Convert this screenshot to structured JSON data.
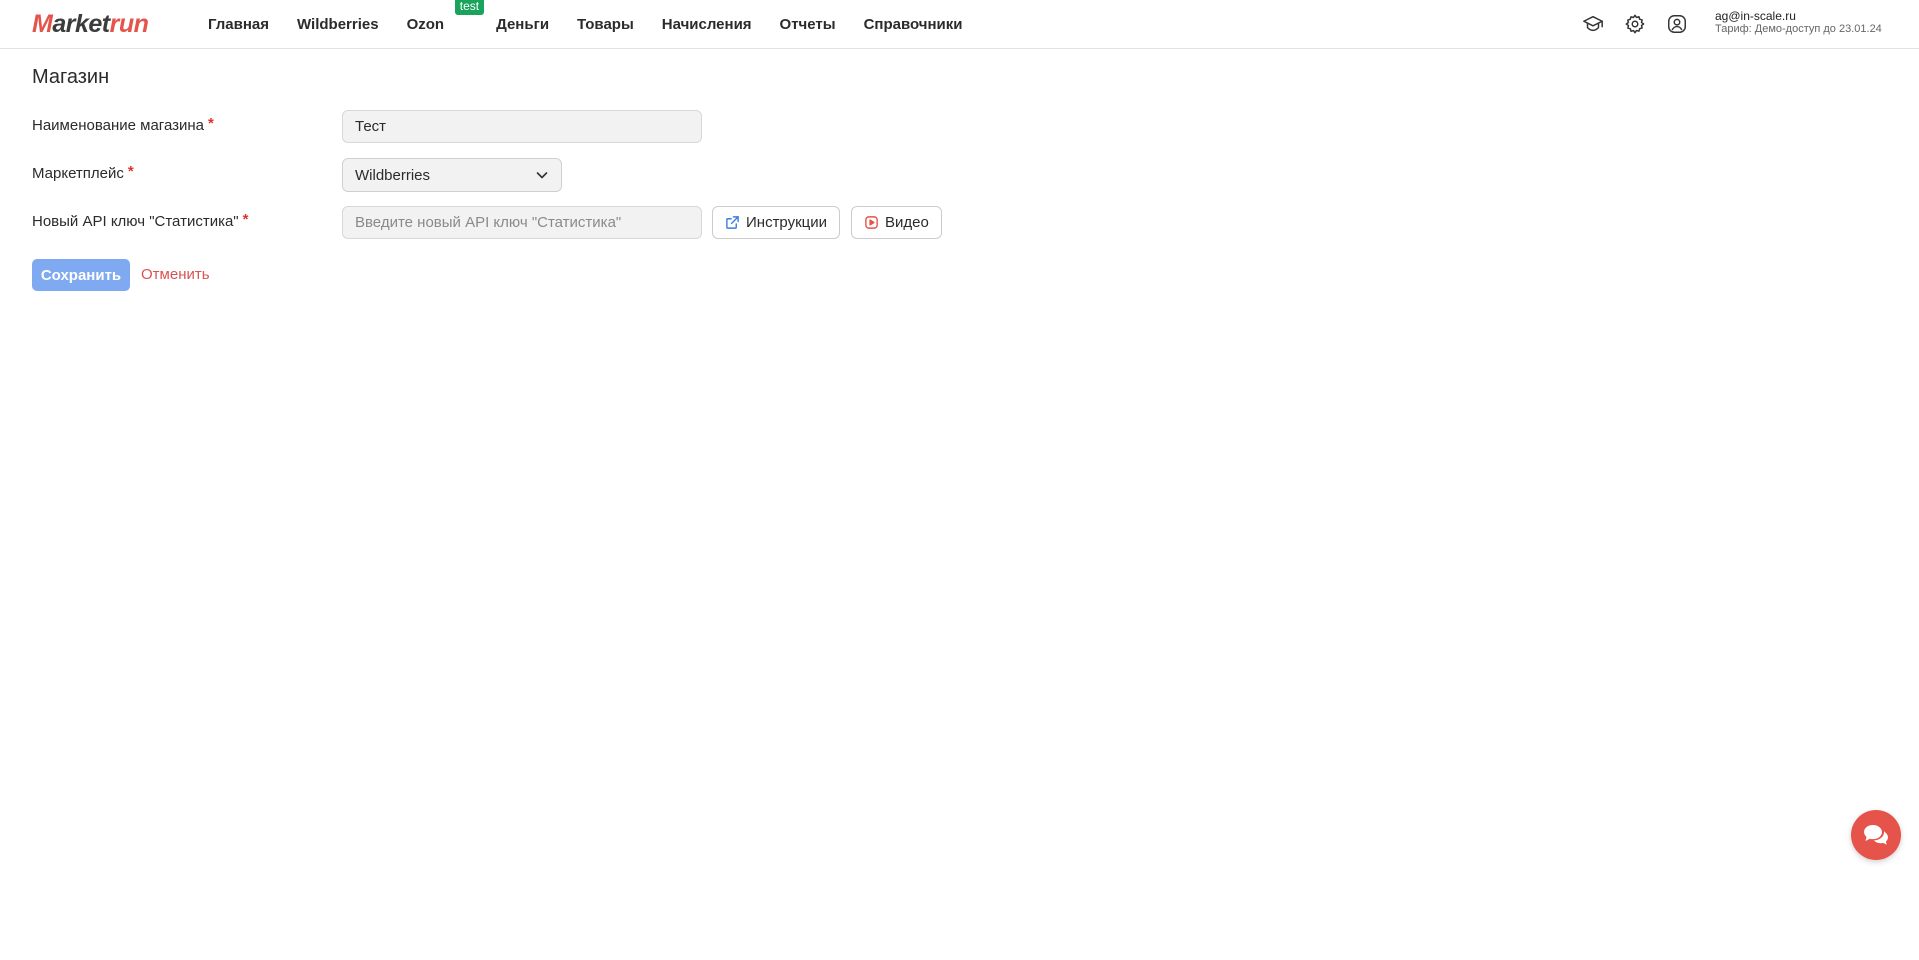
{
  "header": {
    "logo": {
      "m": "M",
      "mid": "arket",
      "run": "run"
    },
    "nav": [
      {
        "label": "Главная"
      },
      {
        "label": "Wildberries"
      },
      {
        "label": "Ozon",
        "badge": "test"
      },
      {
        "label": "Деньги"
      },
      {
        "label": "Товары"
      },
      {
        "label": "Начисления"
      },
      {
        "label": "Отчеты"
      },
      {
        "label": "Справочники"
      }
    ],
    "icons": [
      "graduation-cap-icon",
      "gear-icon",
      "user-icon"
    ],
    "user": {
      "email": "ag@in-scale.ru",
      "tariff": "Тариф: Демо-доступ до 23.01.24"
    }
  },
  "page": {
    "title": "Магазин"
  },
  "form": {
    "shop_name": {
      "label": "Наименование магазина",
      "required_mark": "*",
      "value": "Тест"
    },
    "marketplace": {
      "label": "Маркетплейс",
      "required_mark": "*",
      "selected": "Wildberries"
    },
    "api_key": {
      "label": "Новый API ключ \"Статистика\"",
      "required_mark": "*",
      "placeholder": "Введите новый API ключ \"Статистика\"",
      "value": ""
    },
    "instructions_label": "Инструкции",
    "video_label": "Видео",
    "save_label": "Сохранить",
    "cancel_label": "Отменить"
  },
  "colors": {
    "brand": "#e5534b",
    "save_button": "#7fa9f0",
    "required": "#e03131",
    "badge": "#1aa35a",
    "cancel": "#d9534f"
  }
}
